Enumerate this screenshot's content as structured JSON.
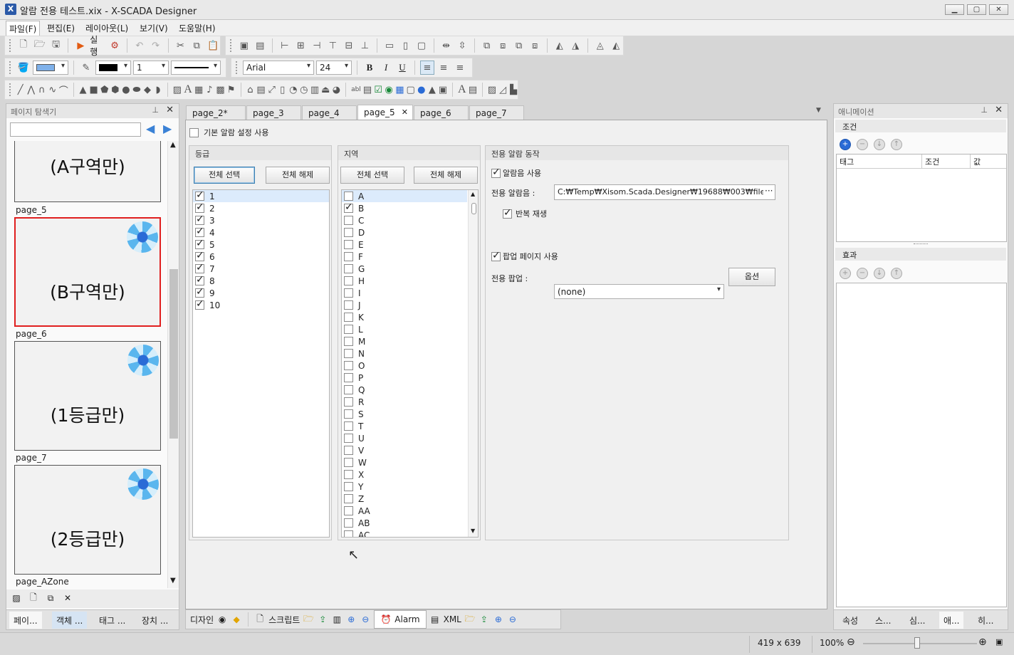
{
  "window": {
    "title": "알람 전용 테스트.xix - X-SCADA Designer",
    "app_icon": "X",
    "min_label": "▁",
    "max_label": "▢",
    "close_label": "✕"
  },
  "menu": [
    "파일(F)",
    "편집(E)",
    "레이아웃(L)",
    "보기(V)",
    "도움말(H)"
  ],
  "toolbar": {
    "run_label": "실행",
    "font_name": "Arial",
    "font_size": "24",
    "line_width": "1",
    "bold": "B",
    "italic": "I",
    "underline": "U"
  },
  "explorer": {
    "title": "페이지 탐색기",
    "search_placeholder": "",
    "thumbs": [
      {
        "text": "(A구역만)",
        "label": "page_5"
      },
      {
        "text": "(B구역만)",
        "label": "page_6"
      },
      {
        "text": "(1등급만)",
        "label": "page_7"
      },
      {
        "text": "(2등급만)",
        "label": "page_AZone"
      }
    ],
    "bottom_tabs": [
      "페이...",
      "객체 ...",
      "태그 ...",
      "장치 ..."
    ]
  },
  "doc_tabs": [
    "page_2*",
    "page_3",
    "page_4",
    "page_5",
    "page_6",
    "page_7"
  ],
  "alarm": {
    "use_default_label": "기본 알람 설정 사용",
    "grade": {
      "title": "등급",
      "select_all": "전체 선택",
      "clear_all": "전체 해제",
      "items": [
        "1",
        "2",
        "3",
        "4",
        "5",
        "6",
        "7",
        "8",
        "9",
        "10"
      ]
    },
    "area": {
      "title": "지역",
      "select_all": "전체 선택",
      "clear_all": "전체 해제",
      "items": [
        "A",
        "B",
        "C",
        "D",
        "E",
        "F",
        "G",
        "H",
        "I",
        "J",
        "K",
        "L",
        "M",
        "N",
        "O",
        "P",
        "Q",
        "R",
        "S",
        "T",
        "U",
        "V",
        "W",
        "X",
        "Y",
        "Z",
        "AA",
        "AB",
        "AC"
      ],
      "checked": [
        "B"
      ]
    },
    "action": {
      "title": "전용 알람 동작",
      "use_sound_label": "알람음 사용",
      "sound_label": "전용 알람음 :",
      "sound_value": "C:₩Temp₩Xisom.Scada.Designer₩19688₩003₩file",
      "browse_label": "···",
      "repeat_label": "반복 재생",
      "use_popup_label": "팝업 페이지 사용",
      "popup_label": "전용 팝업 :",
      "popup_value": "(none)",
      "options_label": "옵션"
    }
  },
  "bottom_toolbar": {
    "design_label": "디자인",
    "script_label": "스크립트",
    "alarm_label": "Alarm",
    "xml_label": "XML"
  },
  "animation": {
    "title": "애니메이션",
    "condition_title": "조건",
    "columns": [
      "태그",
      "조건",
      "값"
    ],
    "effect_title": "효과",
    "bottom_tabs": [
      "속성",
      "스...",
      "심...",
      "애...",
      "히..."
    ]
  },
  "status": {
    "size": "419 x 639",
    "zoom": "100%"
  }
}
